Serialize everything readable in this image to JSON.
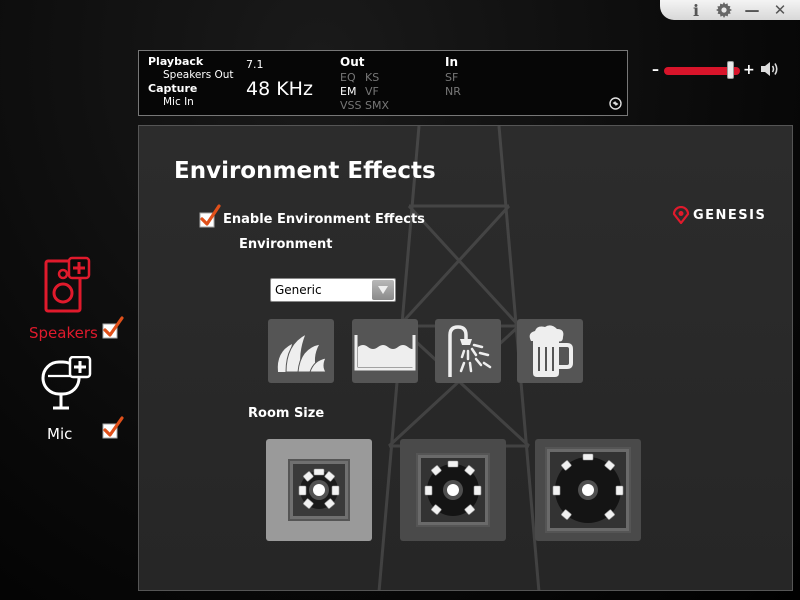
{
  "window": {
    "controls": {
      "info": "i",
      "minimize": "—",
      "close": "✕"
    }
  },
  "status": {
    "playback_label": "Playback",
    "playback_device": "Speakers Out",
    "capture_label": "Capture",
    "capture_device": "Mic In",
    "channels": "7.1",
    "sample_rate": "48 KHz",
    "out_header": "Out",
    "in_header": "In",
    "out_flags": [
      {
        "label": "EQ",
        "active": false
      },
      {
        "label": "KS",
        "active": false
      },
      {
        "label": "EM",
        "active": true
      },
      {
        "label": "VF",
        "active": false
      },
      {
        "label": "VSS",
        "active": false
      },
      {
        "label": "SMX",
        "active": false
      }
    ],
    "in_flags": [
      {
        "label": "SF",
        "active": false
      },
      {
        "label": "NR",
        "active": false
      }
    ]
  },
  "volume": {
    "minus": "–",
    "plus": "+",
    "level": 0.88
  },
  "sidebar": {
    "speakers": {
      "label": "Speakers",
      "checked": true
    },
    "mic": {
      "label": "Mic",
      "checked": true
    }
  },
  "main": {
    "title": "Environment Effects",
    "enable_label": "Enable Environment Effects",
    "enable_checked": true,
    "environment_label": "Environment",
    "environment_value": "Generic",
    "environment_presets": [
      "opera-house-icon",
      "water-icon",
      "shower-icon",
      "beer-mug-icon"
    ],
    "room_size_label": "Room Size",
    "room_sizes": [
      "small",
      "medium",
      "large"
    ],
    "room_size_selected": "small",
    "brand": "GENESIS"
  },
  "colors": {
    "accent_red": "#d8142a",
    "panel_bg": "#2a2a2a",
    "button_bg": "#555555"
  }
}
